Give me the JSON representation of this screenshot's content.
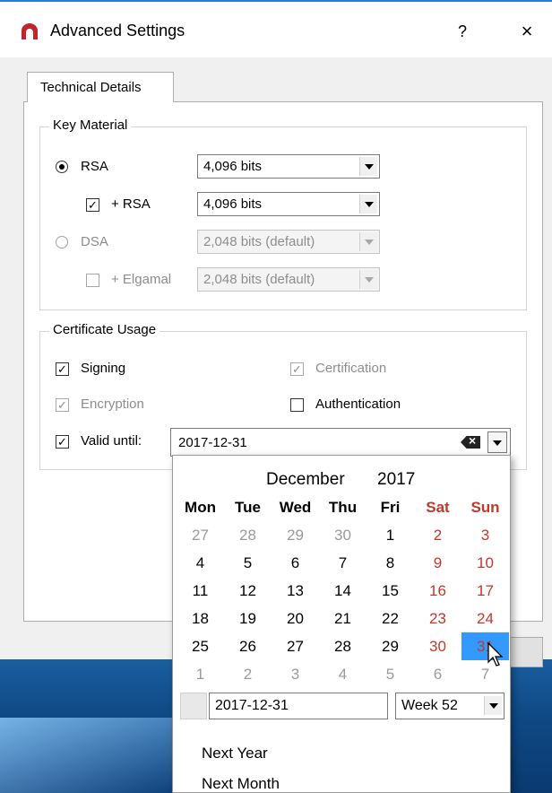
{
  "window": {
    "title": "Advanced Settings",
    "help_label": "?",
    "close_label": "×"
  },
  "tabs": [
    {
      "label": "Technical Details",
      "active": true
    }
  ],
  "key_material": {
    "title": "Key Material",
    "rsa": {
      "label": "RSA",
      "selected": true,
      "value": "4,096 bits"
    },
    "rsa_sub": {
      "label": "+ RSA",
      "checked": true,
      "value": "4,096 bits"
    },
    "dsa": {
      "label": "DSA",
      "selected": false,
      "value": "2,048 bits (default)"
    },
    "elgamal": {
      "label": "+ Elgamal",
      "checked": false,
      "value": "2,048 bits (default)"
    }
  },
  "certificate_usage": {
    "title": "Certificate Usage",
    "signing": {
      "label": "Signing",
      "checked": true
    },
    "certification": {
      "label": "Certification",
      "checked": true
    },
    "encryption": {
      "label": "Encryption",
      "checked": true
    },
    "authentication": {
      "label": "Authentication",
      "checked": false
    },
    "valid_until": {
      "label": "Valid until:",
      "checked": true,
      "value": "2017-12-31"
    }
  },
  "calendar": {
    "month": "December",
    "year": "2017",
    "weekdays": [
      "Mon",
      "Tue",
      "Wed",
      "Thu",
      "Fri",
      "Sat",
      "Sun"
    ],
    "weeks": [
      [
        "27",
        "28",
        "29",
        "30",
        "1",
        "2",
        "3"
      ],
      [
        "4",
        "5",
        "6",
        "7",
        "8",
        "9",
        "10"
      ],
      [
        "11",
        "12",
        "13",
        "14",
        "15",
        "16",
        "17"
      ],
      [
        "18",
        "19",
        "20",
        "21",
        "22",
        "23",
        "24"
      ],
      [
        "25",
        "26",
        "27",
        "28",
        "29",
        "30",
        "31"
      ],
      [
        "1",
        "2",
        "3",
        "4",
        "5",
        "6",
        "7"
      ]
    ],
    "selected_day": "31",
    "date_field": "2017-12-31",
    "week_label": "Week 52",
    "next_year": "Next Year",
    "next_month": "Next Month"
  },
  "colors": {
    "weekend": "#c0392b",
    "selection": "#3399ff",
    "title_accent": "#2b79d0"
  }
}
